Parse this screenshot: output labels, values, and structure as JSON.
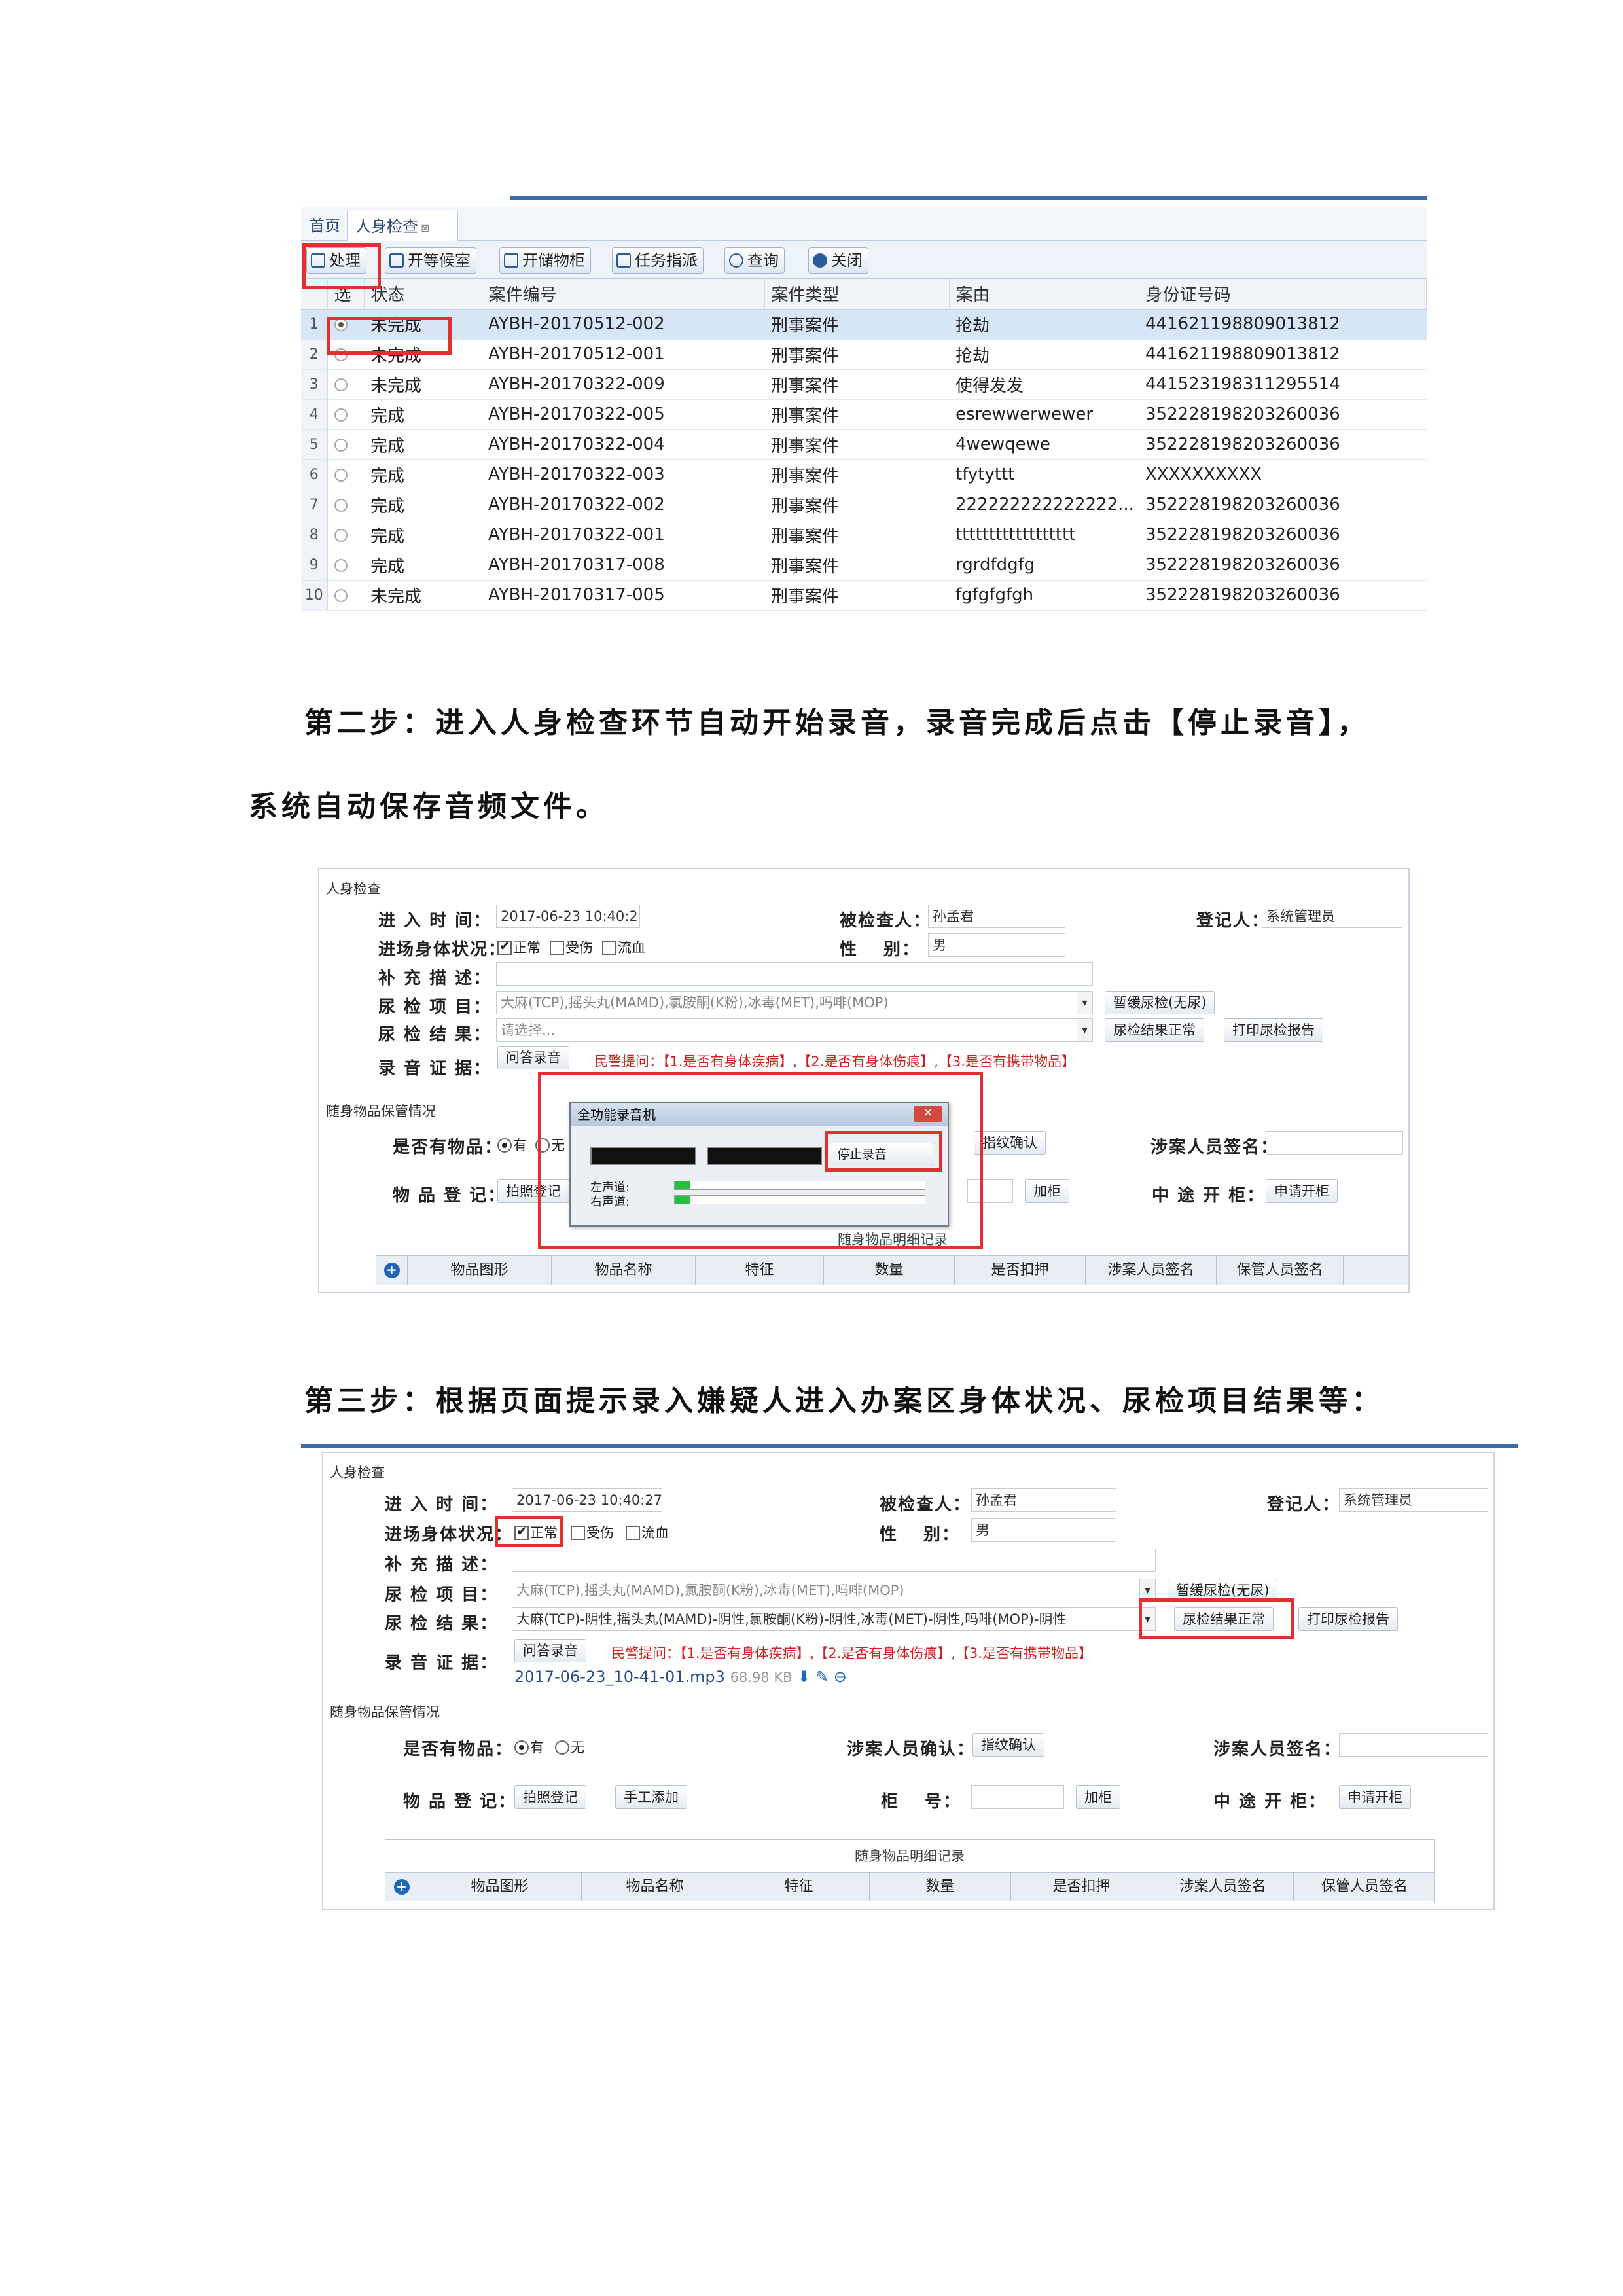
{
  "shot1": {
    "tabs": {
      "home": "首页",
      "active": "人身检查"
    },
    "toolbar": [
      "处理",
      "开等候室",
      "开储物柜",
      "任务指派",
      "查询",
      "关闭"
    ],
    "columns": [
      "选",
      "状态",
      "案件编号",
      "案件类型",
      "案由",
      "身份证号码"
    ],
    "rows": [
      {
        "idx": "1",
        "status": "未完成",
        "case_no": "AYBH-20170512-002",
        "type": "刑事案件",
        "reason": "抢劫",
        "id": "441621198809013812",
        "selected": true
      },
      {
        "idx": "2",
        "status": "未完成",
        "case_no": "AYBH-20170512-001",
        "type": "刑事案件",
        "reason": "抢劫",
        "id": "441621198809013812"
      },
      {
        "idx": "3",
        "status": "未完成",
        "case_no": "AYBH-20170322-009",
        "type": "刑事案件",
        "reason": "使得发发",
        "id": "441523198311295514"
      },
      {
        "idx": "4",
        "status": "完成",
        "case_no": "AYBH-20170322-005",
        "type": "刑事案件",
        "reason": "esrewwerwewer",
        "id": "352228198203260036"
      },
      {
        "idx": "5",
        "status": "完成",
        "case_no": "AYBH-20170322-004",
        "type": "刑事案件",
        "reason": "4wewqewe",
        "id": "352228198203260036"
      },
      {
        "idx": "6",
        "status": "完成",
        "case_no": "AYBH-20170322-003",
        "type": "刑事案件",
        "reason": "tfytyttt",
        "id": "XXXXXXXXXX"
      },
      {
        "idx": "7",
        "status": "完成",
        "case_no": "AYBH-20170322-002",
        "type": "刑事案件",
        "reason": "222222222222222...",
        "id": "352228198203260036"
      },
      {
        "idx": "8",
        "status": "完成",
        "case_no": "AYBH-20170322-001",
        "type": "刑事案件",
        "reason": "tttttttttttttttttt",
        "id": "352228198203260036"
      },
      {
        "idx": "9",
        "status": "完成",
        "case_no": "AYBH-20170317-008",
        "type": "刑事案件",
        "reason": "rgrdfdgfg",
        "id": "352228198203260036"
      },
      {
        "idx": "10",
        "status": "未完成",
        "case_no": "AYBH-20170317-005",
        "type": "刑事案件",
        "reason": "fgfgfgfgh",
        "id": "352228198203260036"
      }
    ]
  },
  "steps": {
    "step2_line1": "第二步：进入人身检查环节自动开始录音，录音完成后点击【停止录音】，",
    "step2_line2": "系统自动保存音频文件。",
    "step3": "第三步：根据页面提示录入嫌疑人进入办案区身体状况、尿检项目结果等："
  },
  "form": {
    "section1": "人身检查",
    "section2": "随身物品保管情况",
    "labels": {
      "enter_time": "进 入 时 间：",
      "body_status": "进场身体状况：",
      "supplement": "补 充 描 述：",
      "urine_items": "尿 检 项 目：",
      "urine_result": "尿 检 结 果：",
      "audio": "录 音 证 据：",
      "inspected": "被检查人：",
      "gender": "性　 别：",
      "registrar": "登记人：",
      "has_items": "是否有物品：",
      "item_reg": "物 品 登 记：",
      "person_confirm": "涉案人员确认：",
      "person_sign": "涉案人员签名：",
      "cabinet_no": "柜　 号：",
      "midway_open": "中 途 开 柜："
    },
    "values": {
      "enter_time": "2017-06-23 10:40:27",
      "inspected": "孙孟君",
      "gender": "男",
      "registrar": "系统管理员",
      "urine_items": "大麻(TCP),摇头丸(MAMD),氯胺酮(K粉),冰毒(MET),吗啡(MOP)",
      "urine_result_placeholder": "请选择...",
      "urine_result_filled": "大麻(TCP)-阴性,摇头丸(MAMD)-阴性,氯胺酮(K粉)-阴性,冰毒(MET)-阴性,吗啡(MOP)-阴性",
      "audio_file": "2017-06-23_10-41-01.mp3",
      "audio_size": "68.98 KB"
    },
    "checks": [
      "正常",
      "受伤",
      "流血"
    ],
    "yesno": [
      "有",
      "无"
    ],
    "buttons": {
      "defer_urine": "暂缓尿检(无尿)",
      "urine_normal": "尿检结果正常",
      "print_urine": "打印尿检报告",
      "qa_record": "问答录音",
      "photo_reg": "拍照登记",
      "manual_add": "手工添加",
      "fingerprint": "指纹确认",
      "lock": "加柜",
      "apply_open": "申请开柜"
    },
    "hint": "民警提问：【1.是否有身体疾病】,【2.是否有身体伤痕】,【3.是否有携带物品】",
    "grid_title": "随身物品明细记录",
    "grid_cols": [
      "物品图形",
      "物品名称",
      "特征",
      "数量",
      "是否扣押",
      "涉案人员签名",
      "保管人员签名"
    ]
  },
  "recorder": {
    "title": "全功能录音机",
    "stop": "停止录音",
    "left": "左声道:",
    "right": "右声道:",
    "left_level": 0.06,
    "right_level": 0.06
  },
  "colors": {
    "accent": "#3a6aa8",
    "highlight": "#e03030",
    "hint": "#d21f1f"
  }
}
